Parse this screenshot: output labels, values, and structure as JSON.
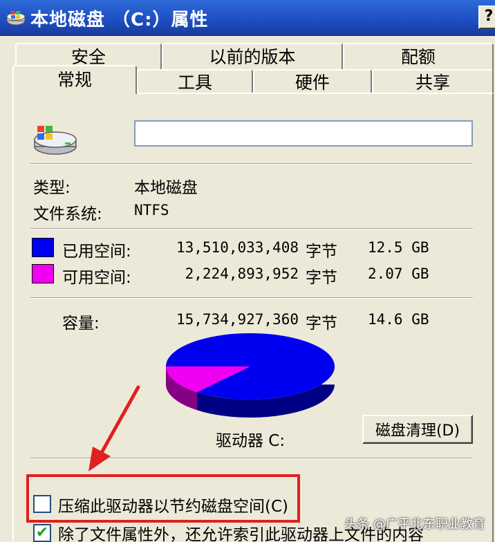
{
  "window": {
    "title": "本地磁盘 （C:）属性",
    "help_label": "?"
  },
  "tabs_back": [
    {
      "label": "安全"
    },
    {
      "label": "以前的版本"
    },
    {
      "label": "配额"
    }
  ],
  "tabs_front": [
    {
      "label": "常规",
      "active": true
    },
    {
      "label": "工具"
    },
    {
      "label": "硬件"
    },
    {
      "label": "共享"
    }
  ],
  "general": {
    "volume_name_value": "",
    "type_label": "类型:",
    "type_value": "本地磁盘",
    "fs_label": "文件系统:",
    "fs_value": "NTFS",
    "used": {
      "label": "已用空间:",
      "bytes": "13,510,033,408",
      "unit": "字节",
      "size": "12.5 GB",
      "color": "#0000f0"
    },
    "free": {
      "label": "可用空间:",
      "bytes": "2,224,893,952",
      "unit": "字节",
      "size": "2.07 GB",
      "color": "#f000f0"
    },
    "capacity": {
      "label": "容量:",
      "bytes": "15,734,927,360",
      "unit": "字节",
      "size": "14.6 GB"
    },
    "drive_label": "驱动器 C:",
    "cleanup_button": "磁盘清理(D)",
    "compress_label": "压缩此驱动器以节约磁盘空间(C)",
    "compress_checked": false,
    "index_label": "除了文件属性外，还允许索引此驱动器上文件的内容",
    "index_checked": true
  },
  "chart_data": {
    "type": "pie",
    "categories": [
      "已用空间",
      "可用空间"
    ],
    "values": [
      13510033408,
      2224893952
    ],
    "colors": [
      "#0000f0",
      "#f000f0"
    ]
  },
  "watermark": "头条 @广平北东职业教育"
}
